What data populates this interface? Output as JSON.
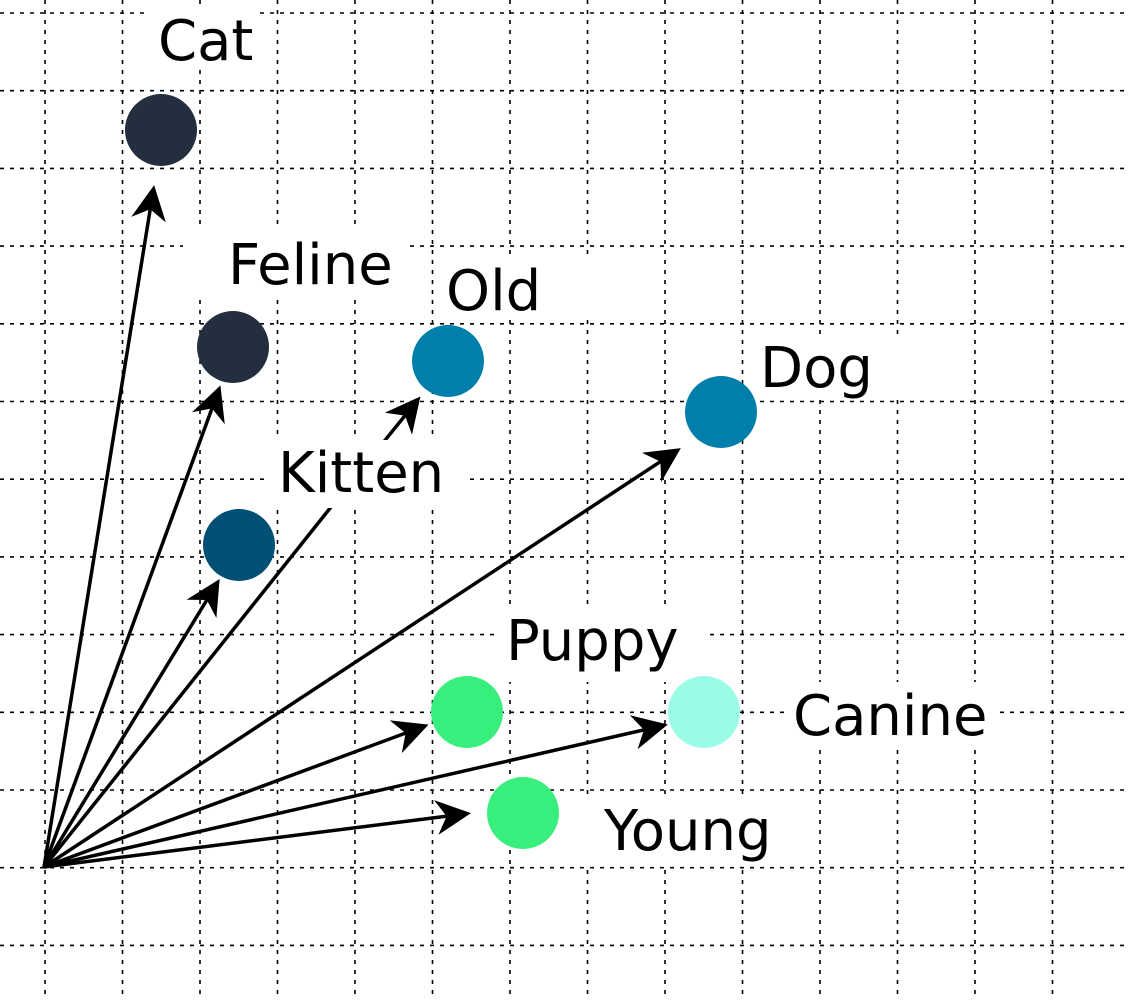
{
  "words": [
    {
      "id": "cat",
      "label": "Cat",
      "color": "#232f3e"
    },
    {
      "id": "feline",
      "label": "Feline",
      "color": "#232f3e"
    },
    {
      "id": "old",
      "label": "Old",
      "color": "#007faa"
    },
    {
      "id": "dog",
      "label": "Dog",
      "color": "#007faa"
    },
    {
      "id": "kitten",
      "label": "Kitten",
      "color": "#004f74"
    },
    {
      "id": "puppy",
      "label": "Puppy",
      "color": "#38ef7d"
    },
    {
      "id": "canine",
      "label": "Canine",
      "color": "#9bfbe8"
    },
    {
      "id": "young",
      "label": "Young",
      "color": "#38ef7d"
    }
  ],
  "grid": {
    "style": "dotted",
    "line_color": "#000000"
  },
  "arrow_color": "#000000"
}
